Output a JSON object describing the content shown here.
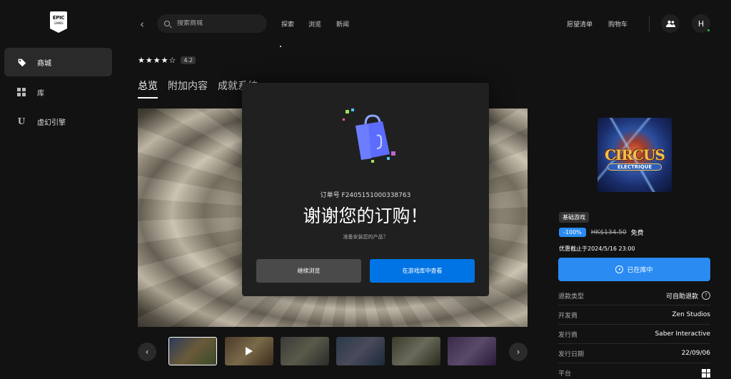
{
  "sidebar": {
    "logo": {
      "line1": "EPIC",
      "line2": "GAMES"
    },
    "items": [
      {
        "label": "商城",
        "icon": "tag-icon"
      },
      {
        "label": "库",
        "icon": "grid-icon"
      },
      {
        "label": "虚幻引擎",
        "icon": "unreal-icon"
      }
    ]
  },
  "topbar": {
    "search_placeholder": "搜索商城",
    "nav": [
      "探索",
      "浏览",
      "新闻"
    ],
    "wishlist": "愿望清单",
    "cart": "购物车",
    "avatar_initial": "H"
  },
  "product": {
    "stars": "★★★★☆",
    "rating": "4.2",
    "tabs": [
      "总览",
      "附加内容",
      "成就系统"
    ],
    "active_tab": 0
  },
  "panel": {
    "cover_title": "CIRCUS",
    "cover_sub": "ELECTRIQUE",
    "base_game": "基础游戏",
    "discount": "-100%",
    "original_price": "HK$134.50",
    "price": "免费",
    "sale_end": "优惠截止于2024/5/16 23:00",
    "in_library": "已在库中",
    "rows": [
      {
        "key": "退款类型",
        "value": "可自助退款"
      },
      {
        "key": "开发商",
        "value": "Zen Studios"
      },
      {
        "key": "发行商",
        "value": "Saber Interactive"
      },
      {
        "key": "发行日期",
        "value": "22/09/06"
      },
      {
        "key": "平台",
        "value": ""
      }
    ]
  },
  "modal": {
    "order_no": "订单号 F2405151000338763",
    "thanks": "谢谢您的订购！",
    "ready": "准备安装您的产品？",
    "continue_label": "继续浏览",
    "view_library_label": "在游戏库中查看"
  },
  "colors": {
    "accent": "#2a8bf2",
    "modal_button": "#0074e4",
    "background": "#121212",
    "panel": "#202020"
  }
}
